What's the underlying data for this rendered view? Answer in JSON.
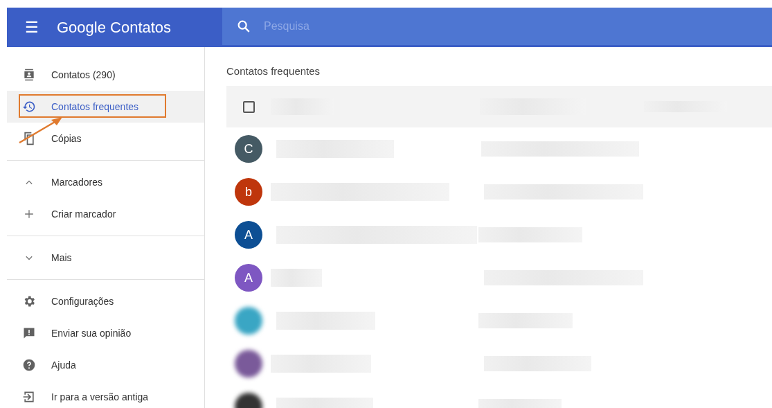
{
  "header": {
    "menu_icon": "☰",
    "title": "Google Contatos",
    "search": {
      "placeholder": "Pesquisa"
    }
  },
  "sidebar": {
    "groups": [
      {
        "items": [
          {
            "label": "Contatos (290)",
            "selected": false,
            "annotated": false
          },
          {
            "label": "Contatos frequentes",
            "selected": true,
            "annotated": true
          },
          {
            "label": "Cópias",
            "selected": false,
            "annotated": false
          }
        ]
      },
      {
        "items": [
          {
            "label": "Marcadores",
            "selected": false,
            "annotated": false
          },
          {
            "label": "Criar marcador",
            "selected": false,
            "annotated": false
          }
        ]
      },
      {
        "items": [
          {
            "label": "Mais",
            "selected": false,
            "annotated": false
          }
        ]
      },
      {
        "items": [
          {
            "label": "Configurações",
            "selected": false,
            "annotated": false
          },
          {
            "label": "Enviar sua opinião",
            "selected": false,
            "annotated": false
          },
          {
            "label": "Ajuda",
            "selected": false,
            "annotated": false
          },
          {
            "label": "Ir para a versão antiga",
            "selected": false,
            "annotated": false
          }
        ]
      }
    ]
  },
  "main": {
    "heading": "Contatos frequentes",
    "select_all": {
      "checked": false
    },
    "contacts": [
      {
        "avatar": {
          "kind": "letter",
          "letter": "C",
          "color": "#455a64"
        }
      },
      {
        "avatar": {
          "kind": "letter",
          "letter": "b",
          "color": "#bf360c"
        }
      },
      {
        "avatar": {
          "kind": "letter",
          "letter": "A",
          "color": "#0d4f94"
        }
      },
      {
        "avatar": {
          "kind": "letter",
          "letter": "A",
          "color": "#7e57c2"
        }
      },
      {
        "avatar": {
          "kind": "photo"
        }
      },
      {
        "avatar": {
          "kind": "photo"
        }
      },
      {
        "avatar": {
          "kind": "photo"
        }
      }
    ]
  }
}
